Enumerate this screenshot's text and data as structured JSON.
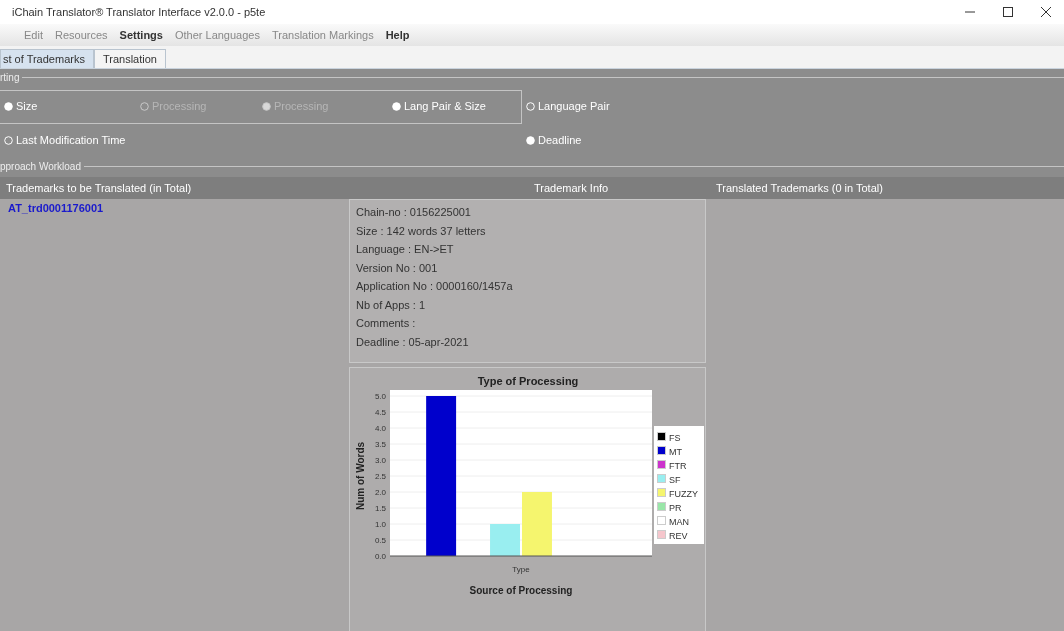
{
  "window": {
    "title": "iChain Translator® Translator Interface v2.0.0 - p5te"
  },
  "menu": [
    {
      "label": "Edit",
      "bold": false
    },
    {
      "label": "Resources",
      "bold": false
    },
    {
      "label": "Settings",
      "bold": true
    },
    {
      "label": "Other Languages",
      "bold": false
    },
    {
      "label": "Translation Markings",
      "bold": false
    },
    {
      "label": "Help",
      "bold": true
    }
  ],
  "tabs": [
    {
      "label": "st of Trademarks",
      "selected": true
    },
    {
      "label": "Translation",
      "selected": false
    }
  ],
  "sorting": {
    "title": "rting",
    "rows": [
      [
        {
          "label": "Size",
          "selected": true,
          "disabled": false
        },
        {
          "label": "Processing",
          "selected": false,
          "disabled": true
        },
        {
          "label": "Processing",
          "selected": true,
          "disabled": true
        },
        {
          "label": "Lang Pair & Size",
          "selected": true,
          "disabled": false
        },
        {
          "label": "Language Pair",
          "selected": false,
          "disabled": false
        }
      ],
      [
        {
          "label": "Last Modification Time",
          "selected": false,
          "disabled": false
        },
        "",
        "",
        "",
        {
          "label": "Deadline",
          "selected": true,
          "disabled": false
        }
      ]
    ]
  },
  "workload": {
    "title": "pproach Workload",
    "columns": [
      "Trademarks to be Translated (in Total)",
      "Trademark Info",
      "Translated Trademarks (0 in Total)"
    ],
    "trademarks": [
      {
        "label": "AT_trd0001176001"
      }
    ],
    "info": [
      "Chain-no : 0156225001",
      "Size : 142 words 37 letters",
      "Language : EN->ET",
      "Version No : 001",
      "Application No : 0000160/1457a",
      "Nb of Apps : 1",
      "Comments :",
      "Deadline : 05-apr-2021"
    ],
    "chart_data": {
      "type": "bar",
      "title": "Type of Processing",
      "xlabel": "Source of Processing",
      "ylabel": "Num of Words",
      "categories": [
        "Type"
      ],
      "grid": true,
      "legend": true,
      "ylim": [
        0,
        5
      ],
      "yticks": [
        {
          "value": 0,
          "label": "0.0"
        },
        {
          "value": 0.5,
          "label": "0.5"
        },
        {
          "value": 1,
          "label": "1.0"
        },
        {
          "value": 1.5,
          "label": "1.5"
        },
        {
          "value": 2,
          "label": "2.0"
        },
        {
          "value": 2.5,
          "label": "2.5"
        },
        {
          "value": 3,
          "label": "3.0"
        },
        {
          "value": 3.5,
          "label": "3.5"
        },
        {
          "value": 4,
          "label": "4.0"
        },
        {
          "value": 4.5,
          "label": "4.5"
        },
        {
          "value": 5,
          "label": "5.0"
        }
      ],
      "series": [
        {
          "name": "FS",
          "color": "#000000",
          "values": [
            0
          ]
        },
        {
          "name": "MT",
          "color": "#0000cc",
          "values": [
            5
          ]
        },
        {
          "name": "FTR",
          "color": "#cc33cc",
          "values": [
            0
          ]
        },
        {
          "name": "SF",
          "color": "#99eef0",
          "values": [
            1
          ]
        },
        {
          "name": "FUZZY",
          "color": "#f5f56e",
          "values": [
            2
          ]
        },
        {
          "name": "PR",
          "color": "#99e6a8",
          "values": [
            0
          ]
        },
        {
          "name": "MAN",
          "color": "#ffffff",
          "values": [
            0
          ]
        },
        {
          "name": "REV",
          "color": "#f5c6cc",
          "values": [
            0
          ]
        }
      ]
    }
  }
}
